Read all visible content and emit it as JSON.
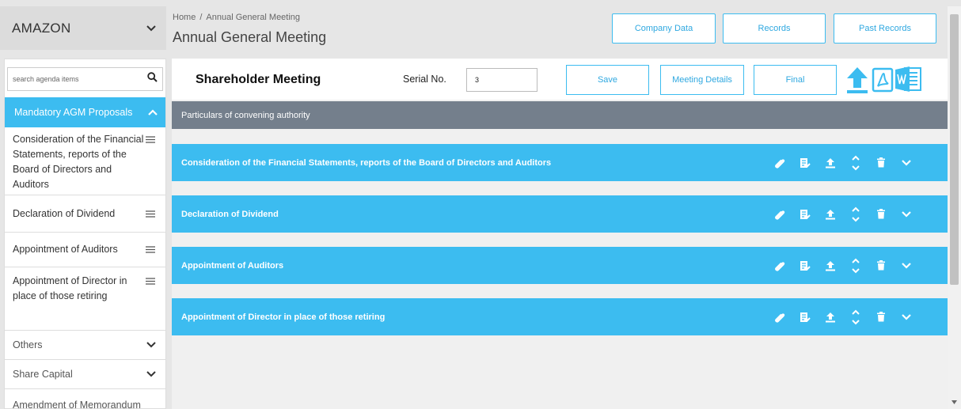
{
  "company": {
    "name": "AMAZON"
  },
  "breadcrumb": {
    "home": "Home",
    "separator": "/",
    "current": "Annual General Meeting"
  },
  "page": {
    "title": "Annual General Meeting"
  },
  "header_buttons": {
    "company_data": "Company Data",
    "records": "Records",
    "past_records": "Past Records"
  },
  "sidebar": {
    "search_placeholder": "search agenda items",
    "active_section": "Mandatory AGM Proposals",
    "items": [
      {
        "label": "Consideration of the Financial Statements, reports of the Board of Directors and Auditors"
      },
      {
        "label": "Declaration of Dividend"
      },
      {
        "label": "Appointment of Auditors"
      },
      {
        "label": "Appointment of Director in place of those retiring"
      }
    ],
    "categories": [
      {
        "label": "Others"
      },
      {
        "label": "Share Capital"
      },
      {
        "label": "Amendment of Memorandum"
      }
    ]
  },
  "main": {
    "title": "Shareholder Meeting",
    "serial_label": "Serial No.",
    "serial_value": "3",
    "buttons": {
      "save": "Save",
      "meeting_details": "Meeting Details",
      "final": "Final"
    },
    "convening_bar": "Particulars of convening authority",
    "agenda_items": [
      {
        "title": "Consideration of the Financial Statements, reports of the Board of Directors and Auditors"
      },
      {
        "title": "Declaration of Dividend"
      },
      {
        "title": "Appointment of Auditors"
      },
      {
        "title": "Appointment of Director in place of those retiring"
      }
    ]
  },
  "colors": {
    "accent": "#3cbcf0",
    "grey_bar": "#747f8c",
    "pdf_icon": "#3cbcf0",
    "word_icon": "#3cbcf0"
  }
}
